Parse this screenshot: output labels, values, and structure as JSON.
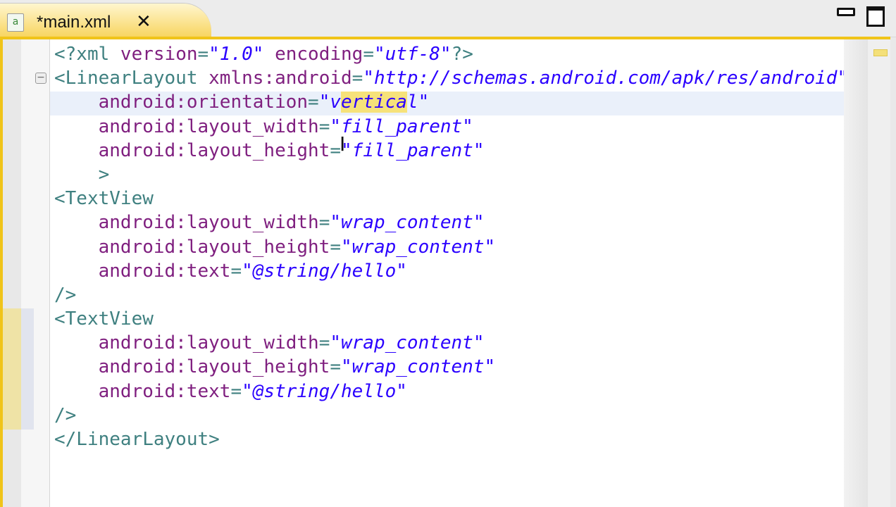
{
  "tab": {
    "title": "*main.xml",
    "close_icon": "close-icon",
    "file_icon": "xml-file-icon"
  },
  "colors": {
    "tag": "#3f8080",
    "attribute": "#7f1f7f",
    "value": "#2a00ff",
    "accent": "#f0c419"
  },
  "code_lines": [
    [
      {
        "t": "<?xml ",
        "c": "tag"
      },
      {
        "t": "version",
        "c": "attr"
      },
      {
        "t": "=",
        "c": "tag"
      },
      {
        "t": "\"1.0\"",
        "c": "val"
      },
      {
        "t": " encoding",
        "c": "attr"
      },
      {
        "t": "=",
        "c": "tag"
      },
      {
        "t": "\"utf-8\"",
        "c": "val"
      },
      {
        "t": "?>",
        "c": "tag"
      }
    ],
    [
      {
        "t": "<LinearLayout ",
        "c": "tag"
      },
      {
        "t": "xmlns:android",
        "c": "attr"
      },
      {
        "t": "=",
        "c": "tag"
      },
      {
        "t": "\"http://schemas.android.com/apk/res/android\"",
        "c": "val"
      }
    ],
    [
      {
        "t": "    android:orientation",
        "c": "attr"
      },
      {
        "t": "=",
        "c": "tag"
      },
      {
        "t": "\"v",
        "c": "val"
      },
      {
        "t": "ertica",
        "c": "val sel"
      },
      {
        "t": "l\"",
        "c": "val"
      }
    ],
    [
      {
        "t": "    android:layout_width",
        "c": "attr"
      },
      {
        "t": "=",
        "c": "tag"
      },
      {
        "t": "\"fill_parent\"",
        "c": "val"
      }
    ],
    [
      {
        "t": "    android:layout_height",
        "c": "attr"
      },
      {
        "t": "=",
        "c": "tag"
      },
      {
        "t": "\"fill_parent\"",
        "c": "val"
      }
    ],
    [
      {
        "t": "    >",
        "c": "tag"
      }
    ],
    [
      {
        "t": "<TextView",
        "c": "tag"
      }
    ],
    [
      {
        "t": "    android:layout_width",
        "c": "attr"
      },
      {
        "t": "=",
        "c": "tag"
      },
      {
        "t": "\"wrap_content\"",
        "c": "val"
      }
    ],
    [
      {
        "t": "    android:layout_height",
        "c": "attr"
      },
      {
        "t": "=",
        "c": "tag"
      },
      {
        "t": "\"wrap_content\"",
        "c": "val"
      }
    ],
    [
      {
        "t": "    android:text",
        "c": "attr"
      },
      {
        "t": "=",
        "c": "tag"
      },
      {
        "t": "\"@string/hello\"",
        "c": "val"
      }
    ],
    [
      {
        "t": "/>",
        "c": "tag"
      }
    ],
    [
      {
        "t": "<TextView",
        "c": "tag"
      }
    ],
    [
      {
        "t": "    android:layout_width",
        "c": "attr"
      },
      {
        "t": "=",
        "c": "tag"
      },
      {
        "t": "\"wrap_content\"",
        "c": "val"
      }
    ],
    [
      {
        "t": "    android:layout_height",
        "c": "attr"
      },
      {
        "t": "=",
        "c": "tag"
      },
      {
        "t": "\"wrap_content\"",
        "c": "val"
      }
    ],
    [
      {
        "t": "    android:text",
        "c": "attr"
      },
      {
        "t": "=",
        "c": "tag"
      },
      {
        "t": "\"@string/hello\"",
        "c": "val"
      }
    ],
    [
      {
        "t": "/>",
        "c": "tag"
      }
    ],
    [
      {
        "t": "</LinearLayout>",
        "c": "tag"
      }
    ]
  ]
}
